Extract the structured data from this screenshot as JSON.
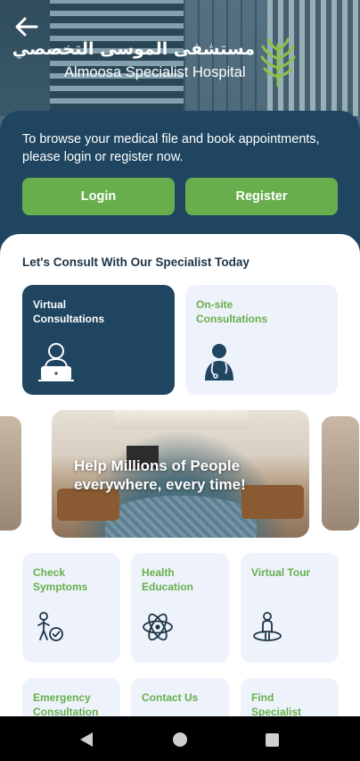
{
  "header": {
    "logo_arabic": "مستشفى الموسى التخصصي",
    "logo_english": "Almoosa Specialist Hospital"
  },
  "login": {
    "message": "To browse your medical file and book appointments, please login or register now.",
    "login_label": "Login",
    "register_label": "Register"
  },
  "main": {
    "section_title": "Let's Consult With Our Specialist Today",
    "consultations": [
      {
        "label": "Virtual Consultations",
        "icon": "doctor-laptop-icon"
      },
      {
        "label": "On-site Consultations",
        "icon": "doctor-icon"
      }
    ],
    "banner": {
      "text": "Help Millions of People everywhere, every time!"
    },
    "services": [
      {
        "label": "Check Symptoms",
        "icon": "check-symptoms-icon"
      },
      {
        "label": "Health Education",
        "icon": "atom-icon"
      },
      {
        "label": "Virtual Tour",
        "icon": "virtual-tour-icon"
      },
      {
        "label": "Emergency Consultation",
        "icon": "emergency-icon"
      },
      {
        "label": "Contact Us",
        "icon": "contact-icon"
      },
      {
        "label": "Find Specialist",
        "icon": "find-specialist-icon"
      }
    ]
  },
  "colors": {
    "navy": "#1f4560",
    "green": "#68ae4c",
    "card_bg": "#eef3fb"
  }
}
